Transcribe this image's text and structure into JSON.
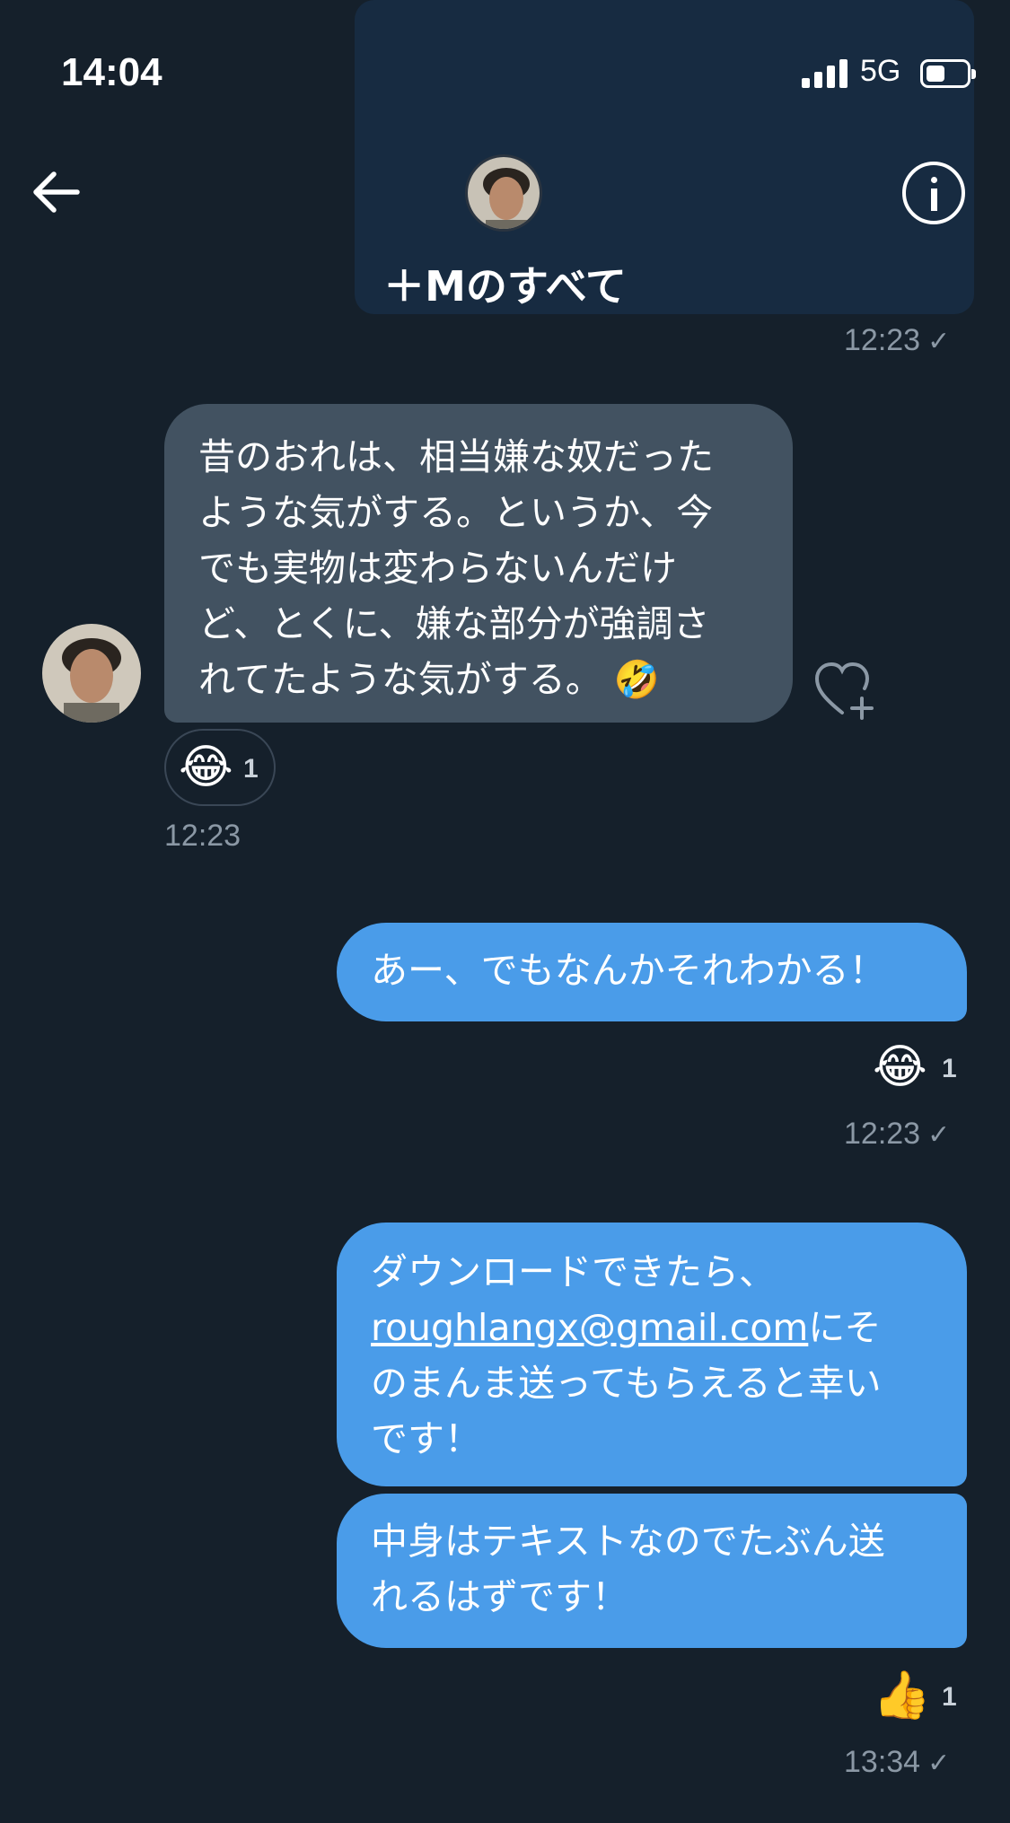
{
  "status": {
    "time": "14:04",
    "network": "5G"
  },
  "header": {
    "title": "＋Mのすべて"
  },
  "messages": {
    "prev_timestamp": "12:23",
    "m1": {
      "lines": [
        "昔のおれは、相当嫌な奴だった",
        "ような気がする。というか、今",
        "でも実物は変わらないんだけ",
        "ど、とくに、嫌な部分が強調さ",
        "れてたような気がする。"
      ],
      "emoji": "🤣",
      "reaction_emoji": "😂",
      "reaction_count": "1",
      "timestamp": "12:23"
    },
    "m2": {
      "text": "あー、でもなんかそれわかる！",
      "reaction_emoji": "😂",
      "reaction_count": "1",
      "timestamp": "12:23"
    },
    "m3": {
      "line1": "ダウンロードできたら、",
      "link": "roughlangx@gmail.com",
      "link_after": "にそ",
      "line3": "のまんま送ってもらえると幸い",
      "line4": "です！"
    },
    "m4": {
      "line1": "中身はテキストなのでたぶん送",
      "line2": "れるはずです！",
      "reaction_emoji": "👍",
      "reaction_count": "1",
      "timestamp": "13:34"
    },
    "check_mark": "✓"
  },
  "colors": {
    "background": "#15202b",
    "incoming_bubble": "#425261",
    "outgoing_bubble": "#4a9ce9",
    "timestamp": "#8b98a5"
  }
}
